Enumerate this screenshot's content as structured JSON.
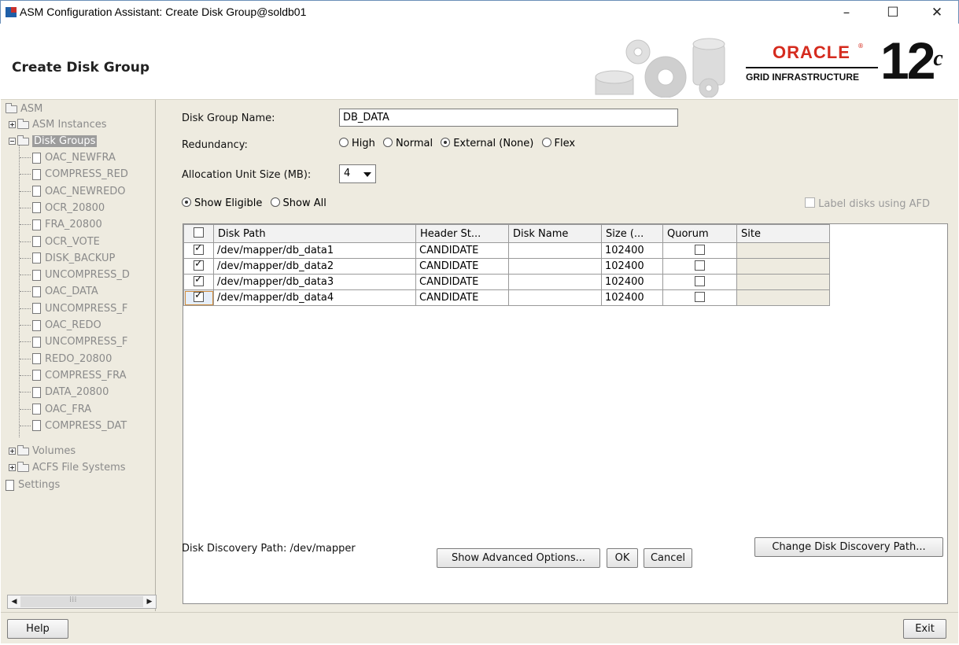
{
  "window": {
    "title": "ASM Configuration Assistant: Create Disk Group@soldb01",
    "minimize": "–",
    "maximize": "☐",
    "close": "✕"
  },
  "header": {
    "page_title": "Create Disk Group",
    "brand": "ORACLE",
    "brand_reg": "®",
    "brand_sub": "GRID INFRASTRUCTURE",
    "version": "12",
    "version_suffix": "c"
  },
  "tree": {
    "root": "ASM",
    "asm_instances": "ASM Instances",
    "disk_groups": "Disk Groups",
    "groups": [
      "OAC_NEWFRA",
      "COMPRESS_RED",
      "OAC_NEWREDO",
      "OCR_20800",
      "FRA_20800",
      "OCR_VOTE",
      "DISK_BACKUP",
      "UNCOMPRESS_D",
      "OAC_DATA",
      "UNCOMPRESS_F",
      "OAC_REDO",
      "UNCOMPRESS_F",
      "REDO_20800",
      "COMPRESS_FRA",
      "DATA_20800",
      "OAC_FRA",
      "COMPRESS_DAT"
    ],
    "volumes": "Volumes",
    "acfs": "ACFS File Systems",
    "settings": "Settings"
  },
  "form": {
    "name_label": "Disk Group Name:",
    "name_value": "DB_DATA",
    "redundancy_label": "Redundancy:",
    "redundancy_options": [
      "High",
      "Normal",
      "External (None)",
      "Flex"
    ],
    "redundancy_selected": "External (None)",
    "au_label": "Allocation Unit Size (MB):",
    "au_value": "4",
    "show_eligible": "Show Eligible",
    "show_all": "Show All",
    "afd_label": "Label disks using AFD"
  },
  "table": {
    "columns": [
      "",
      "Disk Path",
      "Header St...",
      "Disk Name",
      "Size (...",
      "Quorum",
      "Site"
    ],
    "rows": [
      {
        "checked": true,
        "path": "/dev/mapper/db_data1",
        "header": "CANDIDATE",
        "name": "",
        "size": "102400",
        "quorum": false,
        "site": ""
      },
      {
        "checked": true,
        "path": "/dev/mapper/db_data2",
        "header": "CANDIDATE",
        "name": "",
        "size": "102400",
        "quorum": false,
        "site": ""
      },
      {
        "checked": true,
        "path": "/dev/mapper/db_data3",
        "header": "CANDIDATE",
        "name": "",
        "size": "102400",
        "quorum": false,
        "site": ""
      },
      {
        "checked": true,
        "path": "/dev/mapper/db_data4",
        "header": "CANDIDATE",
        "name": "",
        "size": "102400",
        "quorum": false,
        "site": ""
      }
    ]
  },
  "discovery": {
    "label": "Disk Discovery Path:",
    "value": "/dev/mapper",
    "change_button": "Change Disk Discovery Path..."
  },
  "actions": {
    "advanced": "Show Advanced Options...",
    "ok": "OK",
    "cancel": "Cancel",
    "help": "Help",
    "exit": "Exit"
  }
}
